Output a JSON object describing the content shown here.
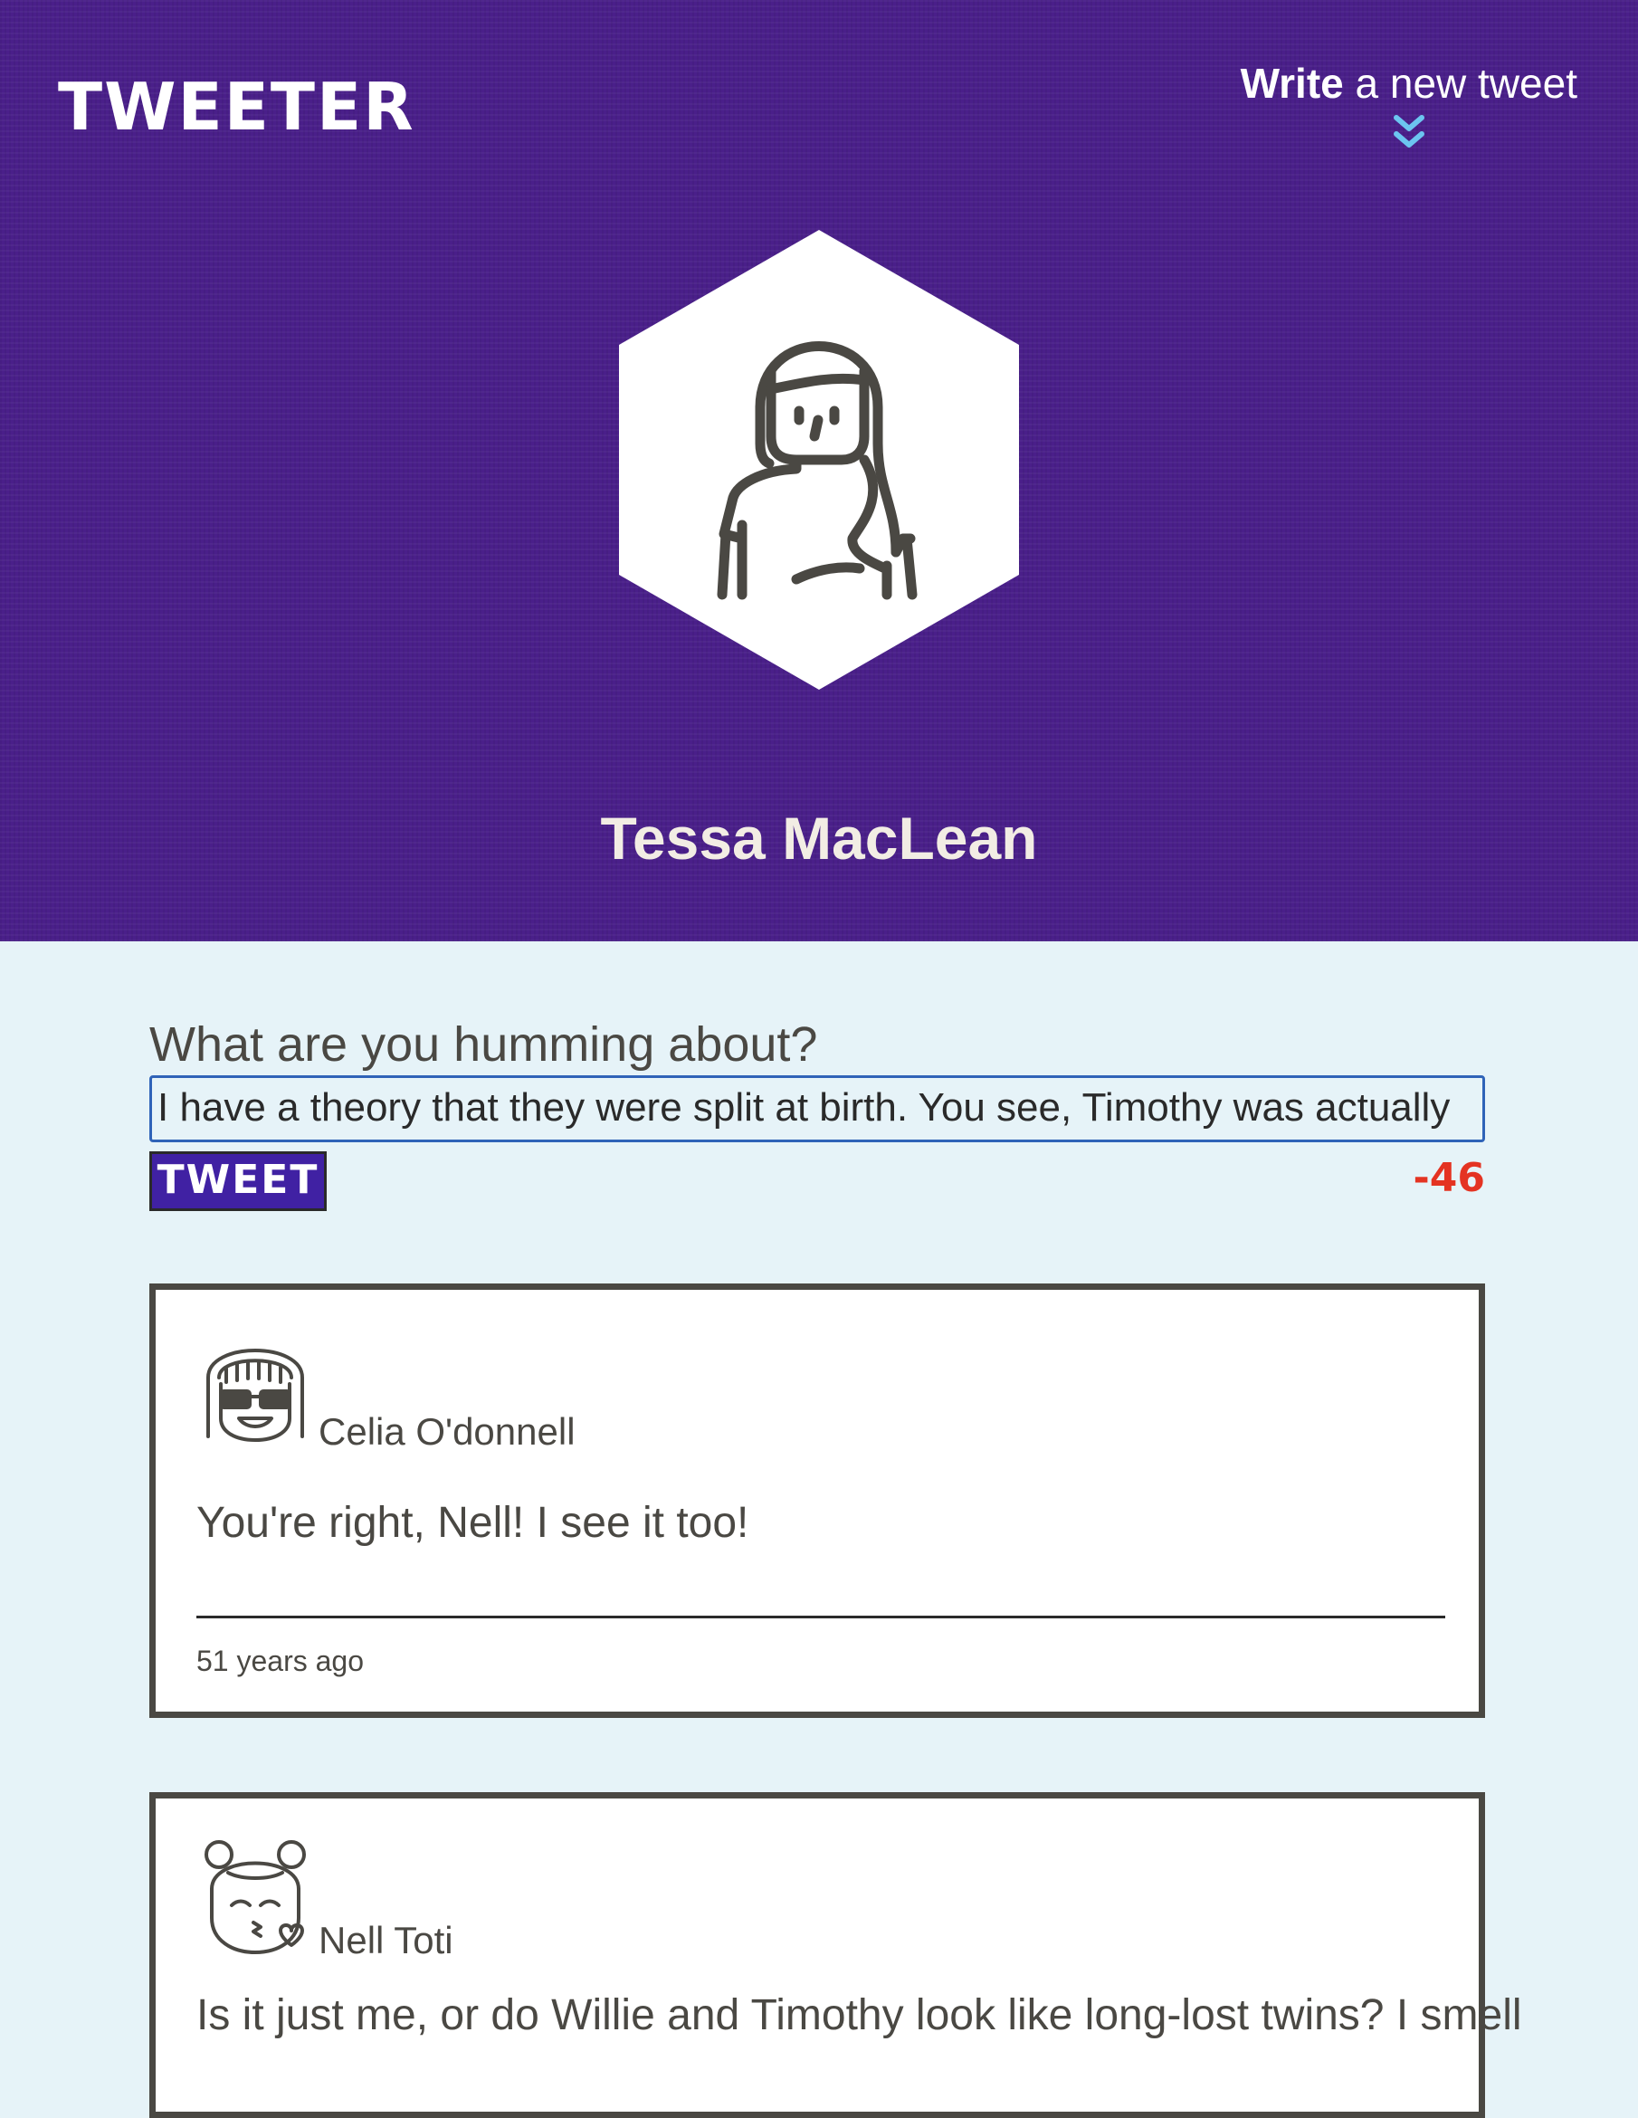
{
  "header": {
    "logo": "TWEETER",
    "compose_toggle": {
      "bold": "Write",
      "rest": " a new tweet",
      "icon": "double-chevron-down-icon"
    },
    "profile": {
      "name": "Tessa MacLean",
      "avatar_icon": "woman-avatar-icon"
    }
  },
  "composer": {
    "label": "What are you humming about?",
    "input_value": "I have a theory that they were split at birth. You see, Timothy was actually",
    "button_label": "TWEET",
    "char_count": "-46"
  },
  "tweets": [
    {
      "author": "Celia O'donnell",
      "avatar_icon": "girl-with-sunglasses-avatar-icon",
      "text": "You're right, Nell! I see it too!",
      "time": "51 years ago"
    },
    {
      "author": "Nell Toti",
      "avatar_icon": "girl-blowing-kiss-avatar-icon",
      "text": "Is it just me, or do Willie and Timothy look like long-lost twins? I smell"
    }
  ],
  "colors": {
    "header_bg": "#4a1f8a",
    "page_bg": "#e6f3f8",
    "accent_button": "#4021a3",
    "counter_negative": "#e43322",
    "chevron": "#6cc5f0"
  }
}
